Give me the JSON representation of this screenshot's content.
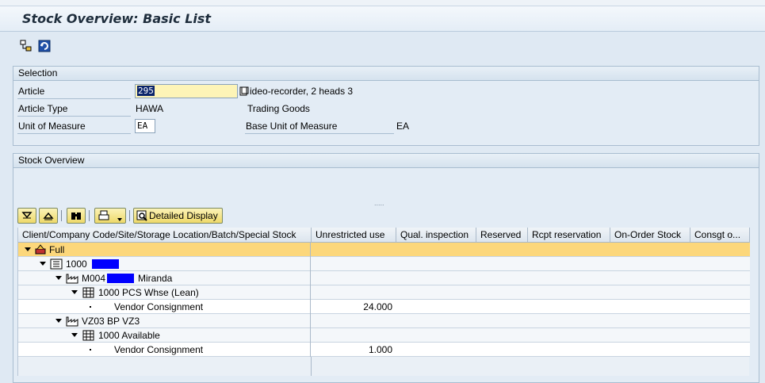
{
  "title": "Stock Overview: Basic List",
  "toolbar": {
    "icons": [
      "hierarchy-icon",
      "refresh-icon"
    ]
  },
  "selection": {
    "header": "Selection",
    "article_label": "Article",
    "article_value": "295",
    "article_desc": "ideo-recorder, 2 heads 3",
    "article_type_label": "Article Type",
    "article_type_value": "HAWA",
    "article_type_desc": "Trading Goods",
    "uom_label": "Unit of Measure",
    "uom_value": "EA",
    "base_uom_label": "Base Unit of Measure",
    "base_uom_value": "EA"
  },
  "stock": {
    "header": "Stock Overview",
    "splitter": ".....",
    "detailed_display_label": "Detailed Display",
    "columns": [
      "Client/Company Code/Site/Storage Location/Batch/Special Stock",
      "Unrestricted use",
      "Qual. inspection",
      "Reserved",
      "Rcpt reservation",
      "On-Order Stock",
      "Consgt o..."
    ],
    "rows": [
      {
        "label": "Full",
        "unrestricted": ""
      },
      {
        "label": "1000",
        "unrestricted": ""
      },
      {
        "label": "M004",
        "suffix": "Miranda",
        "unrestricted": ""
      },
      {
        "label": "1000 PCS Whse (Lean)",
        "unrestricted": ""
      },
      {
        "label": "Vendor Consignment",
        "unrestricted": "24.000"
      },
      {
        "label": "VZ03 BP VZ3",
        "unrestricted": ""
      },
      {
        "label": "1000 Available",
        "unrestricted": ""
      },
      {
        "label": "Vendor Consignment",
        "unrestricted": "1.000"
      }
    ]
  }
}
